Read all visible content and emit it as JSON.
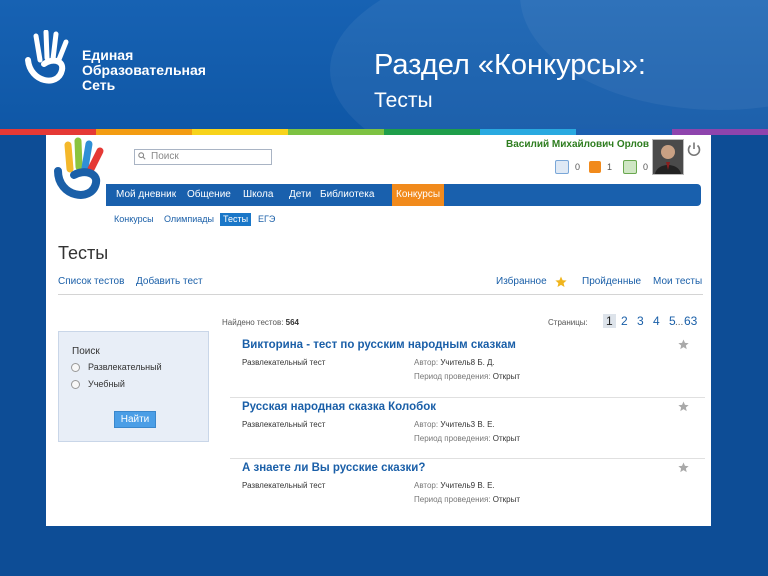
{
  "slide": {
    "logo_lines": [
      "Единая",
      "Образовательная",
      "Сеть"
    ],
    "title": "Раздел «Конкурсы»:",
    "subtitle": "Тесты",
    "rainbow_colors": [
      "#e53935",
      "#f39c12",
      "#f7d31b",
      "#7dc242",
      "#1f9e4a",
      "#29a9e0",
      "#1c5fb0",
      "#8e44ad"
    ]
  },
  "header": {
    "search_placeholder": "Поиск",
    "user_name": "Василий Михайлович Орлов",
    "counters": [
      {
        "icon": "mail-icon",
        "value": "0",
        "color": "#7aa7d8"
      },
      {
        "icon": "friends-icon",
        "value": "1",
        "color": "#f18a1c"
      },
      {
        "icon": "groups-icon",
        "value": "0",
        "color": "#6aa84f"
      }
    ]
  },
  "nav": {
    "items": [
      {
        "label": "Мой дневник"
      },
      {
        "label": "Общение"
      },
      {
        "label": "Школа"
      },
      {
        "label": "Дети"
      },
      {
        "label": "Библиотека"
      },
      {
        "label": "Конкурсы",
        "active": true
      }
    ],
    "accent": "#f18a1c",
    "bar_color": "#1960ad"
  },
  "subnav": {
    "items": [
      {
        "label": "Конкурсы"
      },
      {
        "label": "Олимпиады"
      },
      {
        "label": "Тесты",
        "active": true
      },
      {
        "label": "ЕГЭ"
      }
    ]
  },
  "page": {
    "title": "Тесты",
    "left_links": [
      "Список тестов",
      "Добавить тест"
    ],
    "right_links": [
      "Избранное",
      "Пройденные",
      "Мои тесты"
    ]
  },
  "filter": {
    "heading": "Поиск",
    "options": [
      "Развлекательный",
      "Учебный"
    ],
    "button": "Найти"
  },
  "results": {
    "found_label": "Найдено тестов:",
    "found_count": "564",
    "pages_label": "Страницы:",
    "pages": [
      "1",
      "2",
      "3",
      "4",
      "5",
      "...",
      "63"
    ],
    "current_page": "1",
    "tests": [
      {
        "title": "Викторина - тест по русским народным сказкам",
        "kind": "Развлекательный тест",
        "author_label": "Автор:",
        "author": "Учитель8 Б. Д.",
        "period_label": "Период проведения:",
        "period": "Открыт"
      },
      {
        "title": "Русская народная сказка Колобок",
        "kind": "Развлекательный тест",
        "author_label": "Автор:",
        "author": "Учитель3 В. Е.",
        "period_label": "Период проведения:",
        "period": "Открыт"
      },
      {
        "title": "А знаете ли Вы русские сказки?",
        "kind": "Развлекательный тест",
        "author_label": "Автор:",
        "author": "Учитель9 В. Е.",
        "period_label": "Период проведения:",
        "period": "Открыт"
      }
    ]
  }
}
